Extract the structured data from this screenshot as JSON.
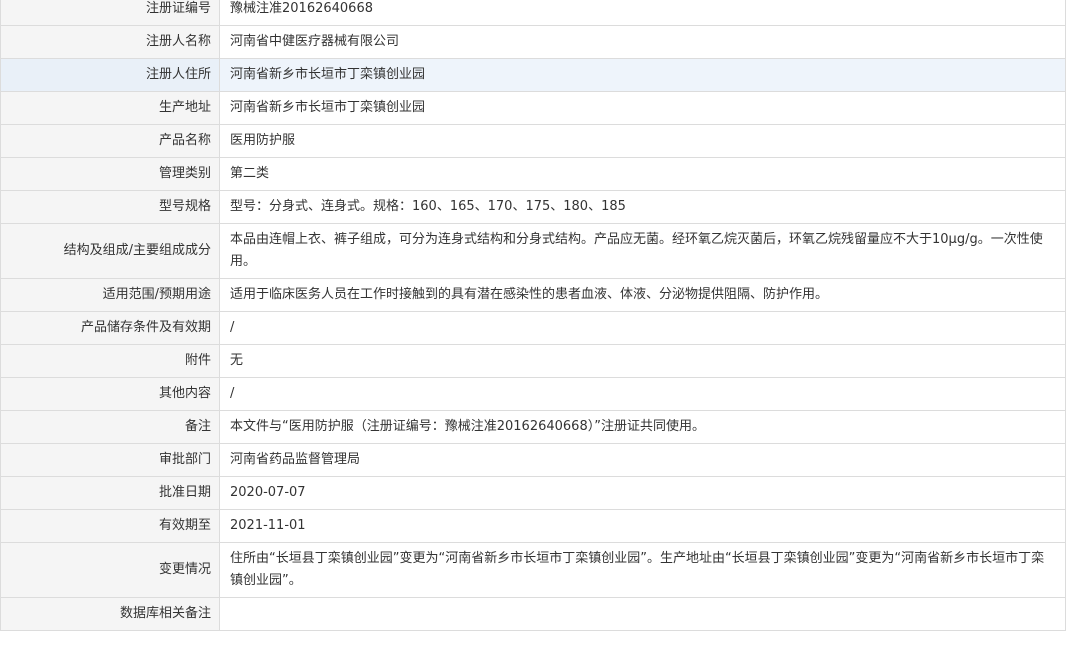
{
  "rows": [
    {
      "label": "注册证编号",
      "value": "豫械注准20162640668"
    },
    {
      "label": "注册人名称",
      "value": "河南省中健医疗器械有限公司"
    },
    {
      "label": "注册人住所",
      "value": "河南省新乡市长垣市丁栾镇创业园"
    },
    {
      "label": "生产地址",
      "value": "河南省新乡市长垣市丁栾镇创业园"
    },
    {
      "label": "产品名称",
      "value": "医用防护服"
    },
    {
      "label": "管理类别",
      "value": "第二类"
    },
    {
      "label": "型号规格",
      "value": "型号：分身式、连身式。规格：160、165、170、175、180、185"
    },
    {
      "label": "结构及组成/主要组成成分",
      "value": "本品由连帽上衣、裤子组成，可分为连身式结构和分身式结构。产品应无菌。经环氧乙烷灭菌后，环氧乙烷残留量应不大于10μg/g。一次性使用。"
    },
    {
      "label": "适用范围/预期用途",
      "value": "适用于临床医务人员在工作时接触到的具有潜在感染性的患者血液、体液、分泌物提供阻隔、防护作用。"
    },
    {
      "label": "产品储存条件及有效期",
      "value": "/"
    },
    {
      "label": "附件",
      "value": "无"
    },
    {
      "label": "其他内容",
      "value": "/"
    },
    {
      "label": "备注",
      "value": "本文件与“医用防护服（注册证编号：豫械注准20162640668）”注册证共同使用。"
    },
    {
      "label": "审批部门",
      "value": "河南省药品监督管理局"
    },
    {
      "label": "批准日期",
      "value": "2020-07-07"
    },
    {
      "label": "有效期至",
      "value": "2021-11-01"
    },
    {
      "label": "变更情况",
      "value": "住所由“长垣县丁栾镇创业园”变更为“河南省新乡市长垣市丁栾镇创业园”。生产地址由“长垣县丁栾镇创业园”变更为“河南省新乡市长垣市丁栾镇创业园”。"
    },
    {
      "label": "数据库相关备注",
      "value": ""
    }
  ]
}
